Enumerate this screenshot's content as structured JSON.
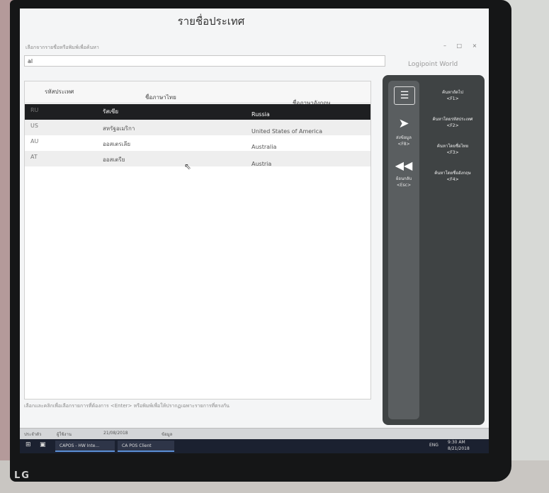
{
  "window": {
    "title": "รายชื่อประเทศ",
    "brand": "Logipoint World",
    "controls": "– □ ×"
  },
  "search": {
    "hint": "เลือกจากรายชื่อหรือพิมพ์เพื่อค้นหา",
    "value": "al"
  },
  "table": {
    "headers": {
      "code": "รหัสประเทศ",
      "name_th": "ชื่อภาษาไทย",
      "name_en": "ชื่อภาษาอังกฤษ"
    },
    "rows": [
      {
        "code": "RU",
        "name_th": "รัสเซีย",
        "name_en": "Russia"
      },
      {
        "code": "US",
        "name_th": "สหรัฐอเมริกา",
        "name_en": "United States of America"
      },
      {
        "code": "AU",
        "name_th": "ออสเตรเลีย",
        "name_en": "Australia"
      },
      {
        "code": "AT",
        "name_th": "ออสเตรีย",
        "name_en": "Austria"
      }
    ]
  },
  "footer": {
    "text": "เลือกและคลิกเพื่อเลือกรายการที่ต้องการ <Enter> หรือพิมพ์เพื่อให้ปรากฏเฉพาะรายการที่ตรงกัน"
  },
  "sidebar": {
    "items": [
      {
        "icon": "list-icon",
        "label": ""
      },
      {
        "icon": "send-icon",
        "label": "ส่งข้อมูล\n<F8>"
      },
      {
        "icon": "rewind-icon",
        "label": "ย้อนกลับ\n<Esc>"
      }
    ],
    "entries": [
      {
        "label": "ค้นหาถัดไป\n<F1>"
      },
      {
        "label": "ค้นหาโดยรหัสประเทศ\n<F2>"
      },
      {
        "label": "ค้นหาโดยชื่อไทย\n<F3>"
      },
      {
        "label": "ค้นหาโดยชื่ออังกฤษ\n<F4>"
      }
    ]
  },
  "statusbar": {
    "date": "21/08/2018",
    "items": [
      "ประจำตัว",
      "ผู้ใช้งาน",
      "ข้อมูล"
    ]
  },
  "taskbar": {
    "app1": "CAPOS - HW Inte...",
    "app2": "CA POS Client",
    "lang": "ENG",
    "time": "9:30 AM",
    "date": "8/21/2018"
  },
  "colors": {
    "selected_row": "#1e1f21",
    "sidebar": "#3f4344",
    "taskbar": "#1b2130"
  }
}
